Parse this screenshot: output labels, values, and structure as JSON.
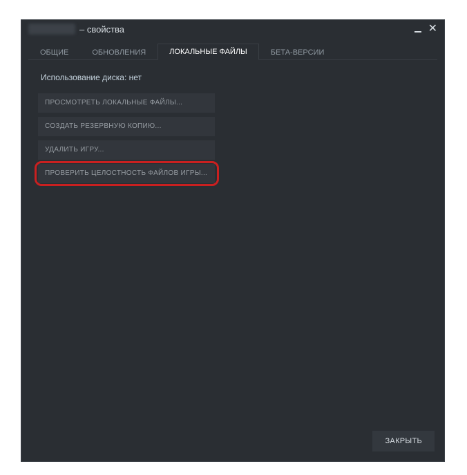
{
  "title": {
    "suffix": "– свойства"
  },
  "tabs": [
    {
      "label": "ОБЩИЕ"
    },
    {
      "label": "ОБНОВЛЕНИЯ"
    },
    {
      "label": "ЛОКАЛЬНЫЕ ФАЙЛЫ"
    },
    {
      "label": "БЕТА-ВЕРСИИ"
    }
  ],
  "content": {
    "disk_usage": "Использование диска: нет",
    "buttons": {
      "browse": "ПРОСМОТРЕТЬ ЛОКАЛЬНЫЕ ФАЙЛЫ...",
      "backup": "СОЗДАТЬ РЕЗЕРВНУЮ КОПИЮ...",
      "delete": "УДАЛИТЬ ИГРУ...",
      "verify": "ПРОВЕРИТЬ ЦЕЛОСТНОСТЬ ФАЙЛОВ ИГРЫ..."
    }
  },
  "footer": {
    "close": "ЗАКРЫТЬ"
  }
}
